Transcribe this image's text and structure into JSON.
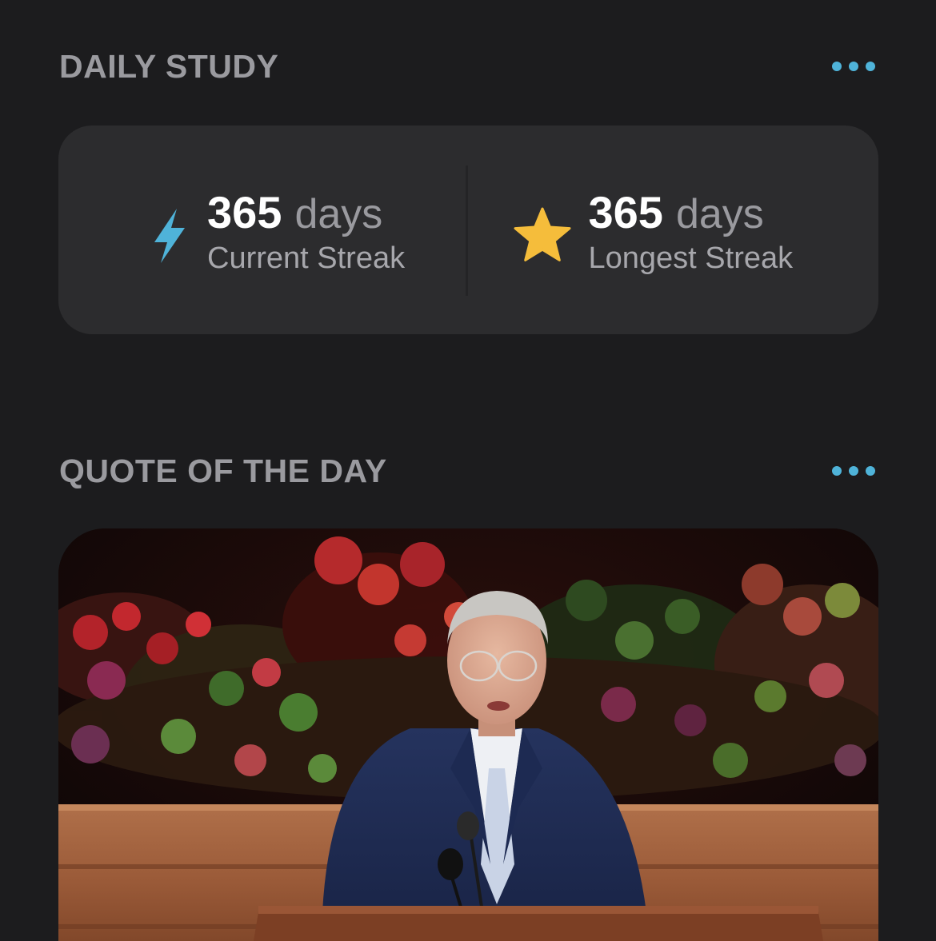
{
  "daily_study": {
    "title": "DAILY STUDY",
    "more_icon": "more-horizontal-icon",
    "current_streak": {
      "icon": "lightning-bolt-icon",
      "number": "365",
      "unit": "days",
      "label": "Current Streak",
      "color": "#4fb3d9"
    },
    "longest_streak": {
      "icon": "star-icon",
      "number": "365",
      "unit": "days",
      "label": "Longest Streak",
      "color": "#f5bd3b"
    }
  },
  "quote_of_the_day": {
    "title": "QUOTE OF THE DAY",
    "more_icon": "more-horizontal-icon",
    "image": "speaker-at-pulpit-photo"
  },
  "colors": {
    "background": "#1c1c1e",
    "card": "#2c2c2e",
    "header_text": "#9a9a9f",
    "accent": "#4fb3d9",
    "star": "#f5bd3b"
  }
}
